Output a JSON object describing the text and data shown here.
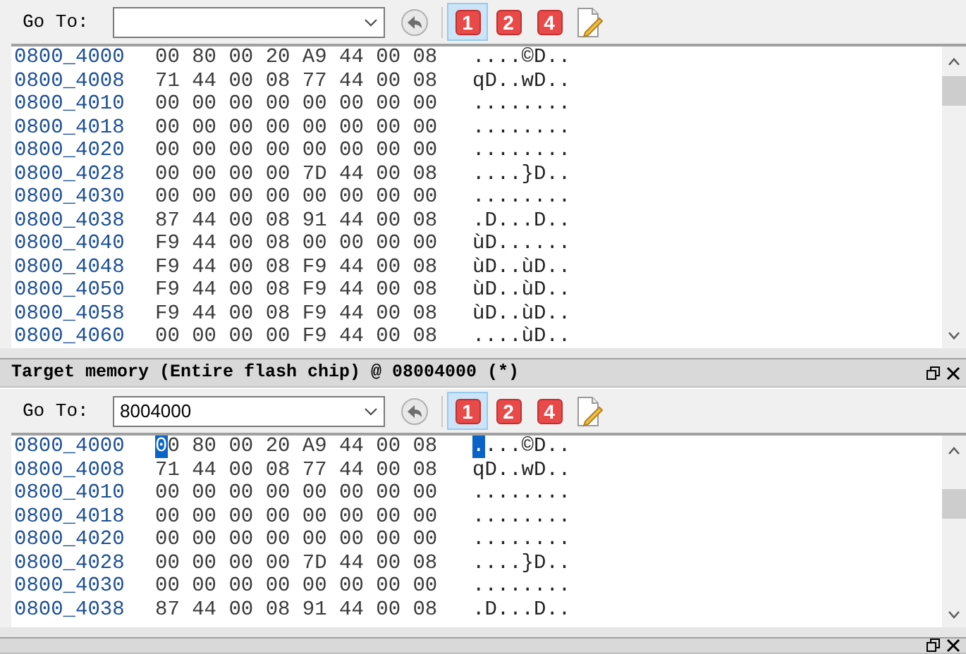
{
  "panels": [
    {
      "goto": {
        "label": "Go To:"
      },
      "buttons": [
        {
          "label": "1",
          "selected": true
        },
        {
          "label": "2",
          "selected": false
        },
        {
          "label": "4",
          "selected": false
        }
      ],
      "rows": [
        {
          "address": "0800_4000",
          "bytes": "00 80 00 20 A9 44 00 08",
          "ascii": "....©D..",
          "cursor": false
        },
        {
          "address": "0800_4008",
          "bytes": "71 44 00 08 77 44 00 08",
          "ascii": "qD..wD..",
          "cursor": false
        },
        {
          "address": "0800_4010",
          "bytes": "00 00 00 00 00 00 00 00",
          "ascii": "........",
          "cursor": false
        },
        {
          "address": "0800_4018",
          "bytes": "00 00 00 00 00 00 00 00",
          "ascii": "........",
          "cursor": false
        },
        {
          "address": "0800_4020",
          "bytes": "00 00 00 00 00 00 00 00",
          "ascii": "........",
          "cursor": false
        },
        {
          "address": "0800_4028",
          "bytes": "00 00 00 00 7D 44 00 08",
          "ascii": "....}D..",
          "cursor": false
        },
        {
          "address": "0800_4030",
          "bytes": "00 00 00 00 00 00 00 00",
          "ascii": "........",
          "cursor": false
        },
        {
          "address": "0800_4038",
          "bytes": "87 44 00 08 91 44 00 08",
          "ascii": ".D...D..",
          "cursor": false
        },
        {
          "address": "0800_4040",
          "bytes": "F9 44 00 08 00 00 00 00",
          "ascii": "ùD......",
          "cursor": false
        },
        {
          "address": "0800_4048",
          "bytes": "F9 44 00 08 F9 44 00 08",
          "ascii": "ùD..ùD..",
          "cursor": false
        },
        {
          "address": "0800_4050",
          "bytes": "F9 44 00 08 F9 44 00 08",
          "ascii": "ùD..ùD..",
          "cursor": false
        },
        {
          "address": "0800_4058",
          "bytes": "F9 44 00 08 F9 44 00 08",
          "ascii": "ùD..ùD..",
          "cursor": false
        },
        {
          "address": "0800_4060",
          "bytes": "00 00 00 00 F9 44 00 08",
          "ascii": "....ùD..",
          "cursor": false
        }
      ]
    },
    {
      "title": "Target memory (Entire flash chip) @ 08004000 (*)",
      "goto": {
        "label": "Go To:",
        "value": "8004000"
      },
      "buttons": [
        {
          "label": "1",
          "selected": true
        },
        {
          "label": "2",
          "selected": false
        },
        {
          "label": "4",
          "selected": false
        }
      ],
      "rows": [
        {
          "address": "0800_4000",
          "bytes": "00 80 00 20 A9 44 00 08",
          "ascii": "....©D..",
          "cursor": true
        },
        {
          "address": "0800_4008",
          "bytes": "71 44 00 08 77 44 00 08",
          "ascii": "qD..wD..",
          "cursor": false
        },
        {
          "address": "0800_4010",
          "bytes": "00 00 00 00 00 00 00 00",
          "ascii": "........",
          "cursor": false
        },
        {
          "address": "0800_4018",
          "bytes": "00 00 00 00 00 00 00 00",
          "ascii": "........",
          "cursor": false
        },
        {
          "address": "0800_4020",
          "bytes": "00 00 00 00 00 00 00 00",
          "ascii": "........",
          "cursor": false
        },
        {
          "address": "0800_4028",
          "bytes": "00 00 00 00 7D 44 00 08",
          "ascii": "....}D..",
          "cursor": false
        },
        {
          "address": "0800_4030",
          "bytes": "00 00 00 00 00 00 00 00",
          "ascii": "........",
          "cursor": false
        },
        {
          "address": "0800_4038",
          "bytes": "87 44 00 08 91 44 00 08",
          "ascii": ".D...D..",
          "cursor": false
        }
      ]
    }
  ]
}
